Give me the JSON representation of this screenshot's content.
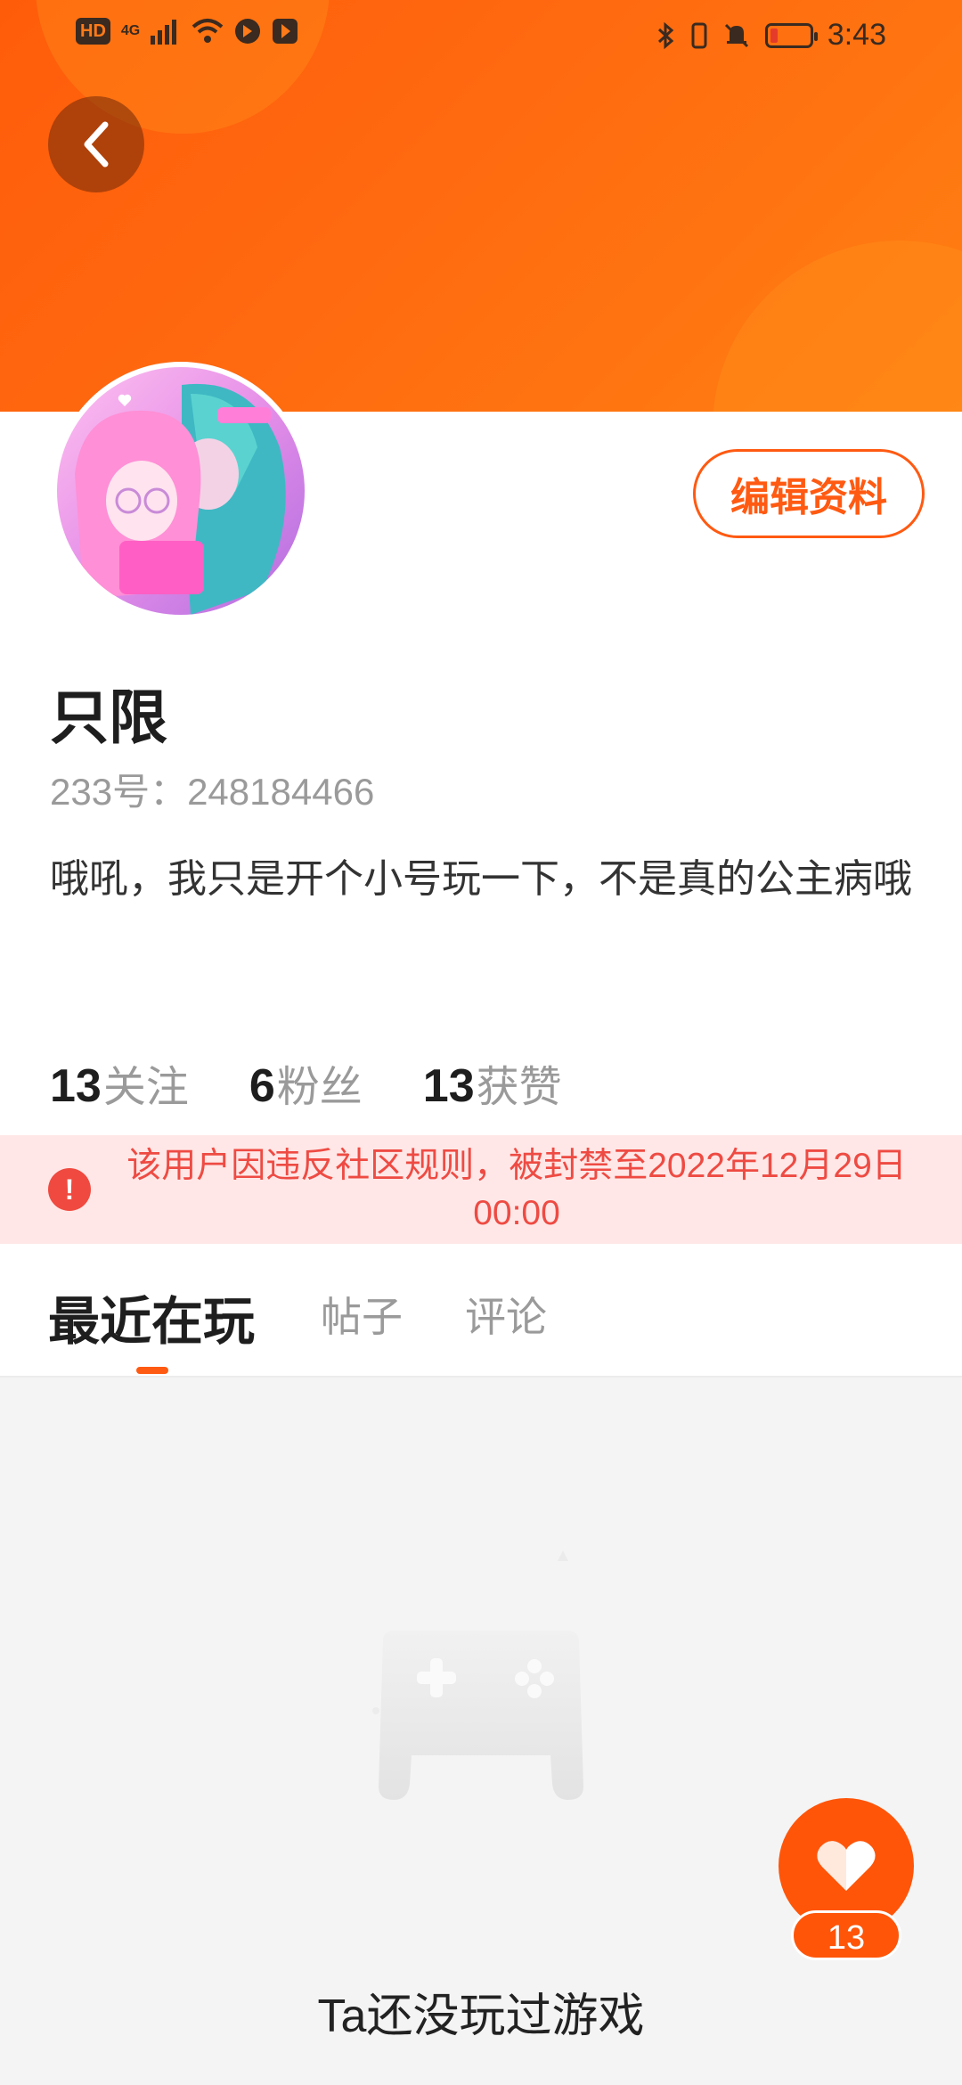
{
  "status_bar": {
    "left_badges": [
      "HD",
      "4G"
    ],
    "time": "3:43"
  },
  "header": {
    "back_icon": "chevron-left-icon"
  },
  "profile": {
    "edit_label": "编辑资料",
    "username": "只限",
    "id_label": "233号：248184466",
    "bio": "哦吼，我只是开个小号玩一下，不是真的公主病哦",
    "stats": [
      {
        "num": "13",
        "label": "关注"
      },
      {
        "num": "6",
        "label": "粉丝"
      },
      {
        "num": "13",
        "label": "获赞"
      }
    ]
  },
  "ban_notice": {
    "icon": "!",
    "text": "该用户因违反社区规则，被封禁至2022年12月29日 00:00"
  },
  "tabs": [
    {
      "label": "最近在玩",
      "active": true
    },
    {
      "label": "帖子",
      "active": false
    },
    {
      "label": "评论",
      "active": false
    }
  ],
  "empty_state": {
    "text": "Ta还没玩过游戏"
  },
  "like_fab": {
    "count": "13"
  },
  "colors": {
    "accent": "#ff5a12",
    "header_start": "#ff5c0a",
    "header_end": "#ff8012",
    "ban_bg": "#ffe7e7",
    "ban_text": "#ee4b43"
  }
}
